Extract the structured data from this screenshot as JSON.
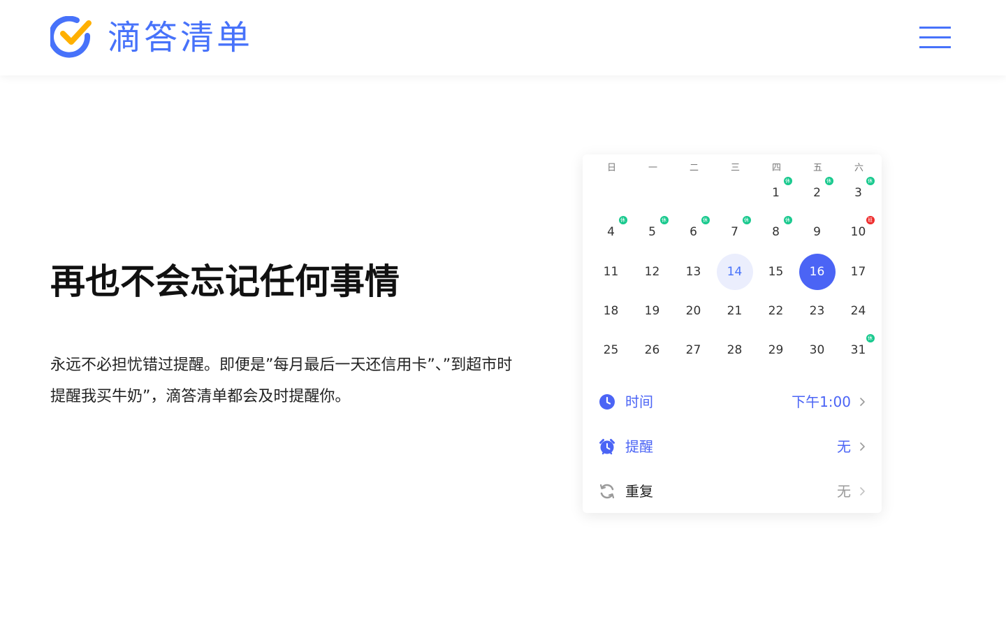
{
  "header": {
    "brand": "滴答清单",
    "accent_color": "#4772fa",
    "logo_check_color": "#ffb000",
    "menu_icon": "hamburger-menu-icon"
  },
  "hero": {
    "headline": "再也不会忘记任何事情",
    "description": "永远不必担忧错过提醒。即便是”每月最后一天还信用卡”、”到超市时提醒我买牛奶”，滴答清单都会及时提醒你。"
  },
  "calendar": {
    "weekdays": [
      "日",
      "一",
      "二",
      "三",
      "四",
      "五",
      "六"
    ],
    "weeks": [
      [
        null,
        null,
        null,
        null,
        "1",
        "2",
        "3"
      ],
      [
        "4",
        "5",
        "6",
        "7",
        "8",
        "9",
        "10"
      ],
      [
        "11",
        "12",
        "13",
        "14",
        "15",
        "16",
        "17"
      ],
      [
        "18",
        "19",
        "20",
        "21",
        "22",
        "23",
        "24"
      ],
      [
        "25",
        "26",
        "27",
        "28",
        "29",
        "30",
        "31"
      ]
    ],
    "today": "14",
    "selected": "16",
    "holiday_days": [
      "1",
      "2",
      "3",
      "4",
      "5",
      "6",
      "7",
      "8",
      "31"
    ],
    "workday_days": [
      "10"
    ],
    "holiday_badge": "休",
    "workday_badge": "班",
    "holiday_color": "#19c98e",
    "workday_color": "#ee2b2b",
    "selected_color": "#4b64f5"
  },
  "settings": [
    {
      "icon": "clock-icon",
      "label": "时间",
      "value": "下午1:00",
      "active": true
    },
    {
      "icon": "alarm-clock-icon",
      "label": "提醒",
      "value": "无",
      "active": true
    },
    {
      "icon": "repeat-icon",
      "label": "重复",
      "value": "无",
      "active": false
    }
  ]
}
